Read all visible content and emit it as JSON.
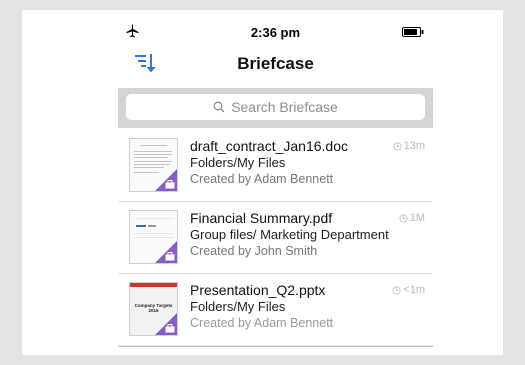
{
  "status_bar": {
    "time": "2:36 pm"
  },
  "nav": {
    "title": "Briefcase"
  },
  "search": {
    "placeholder": "Search Briefcase"
  },
  "files": [
    {
      "name": "draft_contract_Jan16.doc",
      "path": "Folders/My Files",
      "created_by": "Created by Adam Bennett",
      "age": "13m"
    },
    {
      "name": "Financial Summary.pdf",
      "path": "Group files/ Marketing Department",
      "created_by": "Created by John Smith",
      "age": "1M"
    },
    {
      "name": "Presentation_Q2.pptx",
      "path": "Folders/My Files",
      "created_by": "Created by Adam Bennett",
      "age": "<1m",
      "thumb_title": "Company Targets 2016"
    }
  ],
  "icons": [
    "airplane-icon",
    "battery-icon",
    "sort-icon",
    "search-icon",
    "clock-icon",
    "briefcase-icon"
  ],
  "colors": {
    "accent": "#2a7bd3",
    "badge": "#8a5bc5",
    "search_bar_bg": "#d4d4d7"
  }
}
